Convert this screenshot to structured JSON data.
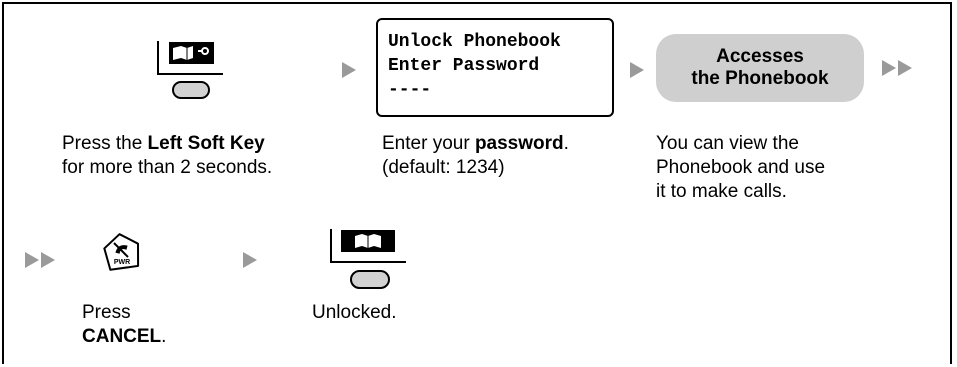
{
  "step1": {
    "pre": "Press the ",
    "bold": "Left Soft Key",
    "post": "for more than 2 seconds."
  },
  "screen": {
    "line1": "Unlock Phonebook",
    "line2": "Enter Password",
    "line3": "----"
  },
  "step2": {
    "pre": "Enter your ",
    "bold": "password",
    "dot": ".",
    "post": "(default: 1234)"
  },
  "result": {
    "line1": "Accesses",
    "line2": "the Phonebook"
  },
  "step3": {
    "line1": "You can view the",
    "line2": "Phonebook and use",
    "line3": "it to make calls."
  },
  "cancel": {
    "pre": "Press",
    "bold": "CANCEL",
    "dot": "."
  },
  "pwr_label": "PWR",
  "unlocked": "Unlocked."
}
